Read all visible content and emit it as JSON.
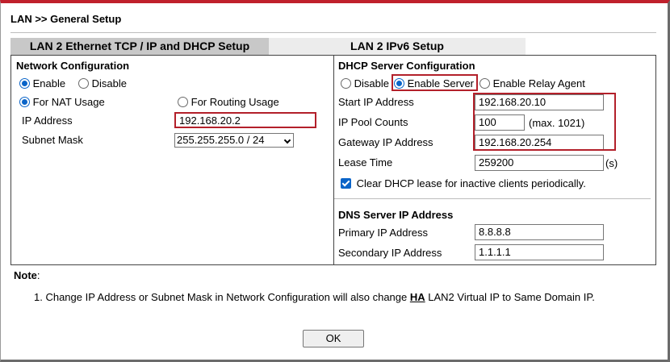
{
  "page": {
    "title": "LAN >> General Setup"
  },
  "tabs": [
    {
      "label": "LAN 2 Ethernet TCP / IP and DHCP Setup",
      "active": true
    },
    {
      "label": "LAN 2 IPv6 Setup",
      "active": false
    }
  ],
  "network": {
    "title": "Network Configuration",
    "enable_label": "Enable",
    "disable_label": "Disable",
    "enabled": true,
    "nat_label": "For NAT Usage",
    "routing_label": "For Routing Usage",
    "mode": "nat",
    "ip_label": "IP Address",
    "ip_value": "192.168.20.2",
    "mask_label": "Subnet Mask",
    "mask_value": "255.255.255.0 / 24"
  },
  "dhcp": {
    "title": "DHCP Server Configuration",
    "disable_label": "Disable",
    "enable_server_label": "Enable Server",
    "relay_label": "Enable Relay Agent",
    "mode": "enable_server",
    "start_ip_label": "Start IP Address",
    "start_ip_value": "192.168.20.10",
    "pool_label": "IP Pool Counts",
    "pool_value": "100",
    "pool_max": "(max. 1021)",
    "gateway_label": "Gateway IP Address",
    "gateway_value": "192.168.20.254",
    "lease_label": "Lease Time",
    "lease_value": "259200",
    "lease_unit": "(s)",
    "clear_lease_label": "Clear DHCP lease for inactive clients periodically.",
    "clear_lease_checked": true
  },
  "dns": {
    "title": "DNS Server IP Address",
    "primary_label": "Primary IP Address",
    "primary_value": "8.8.8.8",
    "secondary_label": "Secondary IP Address",
    "secondary_value": "1.1.1.1"
  },
  "note": {
    "label": "Note",
    "colon": ":",
    "text_before": "1. Change IP Address or Subnet Mask in Network Configuration will also change ",
    "ha": "HA",
    "text_after": " LAN2 Virtual IP to Same Domain IP."
  },
  "ok_label": "OK",
  "colors": {
    "accent_red": "#b3202a",
    "control_blue": "#0a64c8",
    "active_tab": "#c8c8c8"
  }
}
